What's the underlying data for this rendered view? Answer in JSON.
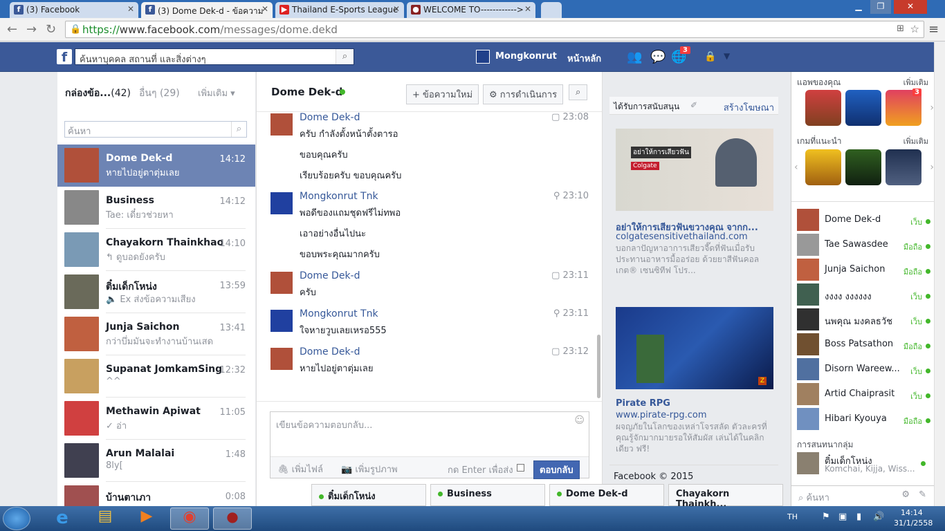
{
  "browser": {
    "tabs": [
      {
        "title": "(3) Facebook",
        "icon": "facebook-icon"
      },
      {
        "title": "(3) Dome Dek-d - ข้อความ",
        "icon": "facebook-icon"
      },
      {
        "title": "Thailand E-Sports League",
        "icon": "youtube-icon"
      },
      {
        "title": "WELCOME TO------------>",
        "icon": "site-icon"
      }
    ],
    "url_proto": "https://",
    "url_host": "www.facebook.com",
    "url_path": "/messages/dome.dekd"
  },
  "fb": {
    "search_placeholder": "ค้นหาบุคคล สถานที่ และสิ่งต่างๆ",
    "user": "Mongkonrut",
    "home": "หน้าหลัก",
    "notif_count": "3"
  },
  "left": {
    "inbox_label": "กล่องข้อ...",
    "inbox_count": "(42)",
    "other_label": "อื่นๆ",
    "other_count": "(29)",
    "more": "เพิ่มเติม",
    "search_placeholder": "ค้นหา",
    "conversations": [
      {
        "name": "Dome Dek-d",
        "preview": "หายไปอยู่ตาตุ่มเลย",
        "time": "14:12",
        "color": "#b0503a"
      },
      {
        "name": "Business",
        "preview": "Tae: เดี๋ยวช่วยหา",
        "time": "14:12",
        "color": "#888"
      },
      {
        "name": "Chayakorn Thainkhao",
        "preview": "↰ ดูบอดยังครับ",
        "time": "14:10",
        "color": "#7a9ab5"
      },
      {
        "name": "ติ๋มเด็กโหน่ง",
        "preview": "🔈 Ex ส่งข้อความเสียง",
        "time": "13:59",
        "color": "#6a6a5a"
      },
      {
        "name": "Junja Saichon",
        "preview": "กว่าบึ่มมันจะทำงานบ้านเสด",
        "time": "13:41",
        "color": "#c06040"
      },
      {
        "name": "Supanat JomkamSing",
        "preview": "^^",
        "time": "12:32",
        "color": "#c8a060"
      },
      {
        "name": "Methawin Apiwat",
        "preview": "✓ อ่า",
        "time": "11:05",
        "color": "#d04040"
      },
      {
        "name": "Arun Malalai",
        "preview": "8ly[",
        "time": "1:48",
        "color": "#404050"
      },
      {
        "name": "บ้านตาเภา",
        "preview": "",
        "time": "0:08",
        "color": "#a05050"
      }
    ]
  },
  "chat": {
    "title": "Dome Dek-d",
    "new_msg": "+ ข้อความใหม่",
    "actions": "⚙ การดำเนินการ",
    "messages": [
      {
        "sender": "Dome Dek-d",
        "time": "23:08",
        "lines": [
          "ครับ กำลังตั้งหน้าตั้งตารอ",
          "ขอบคุณครับ",
          "เรียบร้อยครับ ขอบคุณครับ"
        ],
        "color": "#b0503a"
      },
      {
        "sender": "Mongkonrut Tnk",
        "time": "23:10",
        "lines": [
          "พอดีของแถมชุดฟรีไม่ทพอ",
          "เอาอย่างอื่นไปนะ",
          "ขอบพระคุณมากครับ"
        ],
        "color": "#2040a0"
      },
      {
        "sender": "Dome Dek-d",
        "time": "23:11",
        "lines": [
          "ครับ"
        ],
        "color": "#b0503a"
      },
      {
        "sender": "Mongkonrut Tnk",
        "time": "23:11",
        "lines": [
          "ใจหายวูบเลยเหรอ555"
        ],
        "color": "#2040a0"
      },
      {
        "sender": "Dome Dek-d",
        "time": "23:12",
        "lines": [
          "หายไปอยู่ตาตุ่มเลย"
        ],
        "color": "#b0503a"
      }
    ],
    "reply_placeholder": "เขียนข้อความตอบกลับ...",
    "attach_file": "เพิ่มไฟล์",
    "attach_photo": "เพิ่มรูปภาพ",
    "enter_send": "กด Enter เพื่อส่ง",
    "reply_btn": "ตอบกลับ"
  },
  "ads": {
    "sponsored": "ได้รับการสนับสนุน",
    "create_ad": "สร้างโฆษณา",
    "ad1_title": "อย่าให้การเสียวฟันขวางคุณ จากก...",
    "ad1_url": "colgatesensitivethailand.com",
    "ad1_desc": "บอกลาปัญหาอาการเสียวจี๊ดที่ฟันเมื่อรับประทานอาหารมื้ออร่อย ด้วยยาสีฟันคอลเกต® เซนซิทีฟ โปร...",
    "ad1_img_text": "อย่าให้การเสียวฟัน",
    "ad2_title": "Pirate RPG",
    "ad2_url": "www.pirate-rpg.com",
    "ad2_desc": "ผจญภัยในโลกของเหล่าโจรสลัด ตัวละครที่คุณรู้จักมากมายรอให้สัมผัส เล่นได้ในคลิกเดียว ฟรี!",
    "copyright": "Facebook © 2015"
  },
  "sidebar": {
    "your_apps": "แอพของคุณ",
    "more1": "เพิ่มเติม",
    "rec_games": "เกมที่แนะนำ",
    "more2": "เพิ่มเติม",
    "app_badge": "3",
    "friends": [
      {
        "name": "Dome Dek-d",
        "status": "เว็บ",
        "color": "#b0503a"
      },
      {
        "name": "Tae Sawasdee",
        "status": "มือถือ",
        "color": "#999"
      },
      {
        "name": "Junja Saichon",
        "status": "มือถือ",
        "color": "#c06040"
      },
      {
        "name": "งงงง งงงงงง",
        "status": "เว็บ",
        "color": "#406050"
      },
      {
        "name": "นพคุณ มงคลธวัช",
        "status": "เว็บ",
        "color": "#303030"
      },
      {
        "name": "Boss Patsathon",
        "status": "มือถือ",
        "color": "#705030"
      },
      {
        "name": "Disorn Wareew...",
        "status": "เว็บ",
        "color": "#5070a0"
      },
      {
        "name": "Artid Chaiprasit",
        "status": "เว็บ",
        "color": "#a08060"
      },
      {
        "name": "Hibari Kyouya",
        "status": "มือถือ",
        "color": "#7090c0"
      }
    ],
    "group_title": "การสนทนากลุ่ม",
    "group_name": "ติ๋มเด็กโหน่ง",
    "group_members": "Komchai, Kijja, Wiss...",
    "search": "ค้นหา"
  },
  "chat_tabs": [
    "ติ๋มเด็กโหน่ง",
    "Business",
    "Dome Dek-d",
    "Chayakorn Thainkh..."
  ],
  "taskbar": {
    "lang": "TH",
    "time": "14:14",
    "date": "31/1/2558"
  }
}
